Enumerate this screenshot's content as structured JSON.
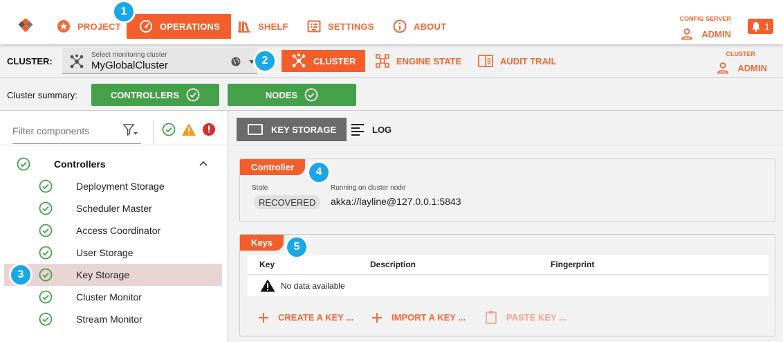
{
  "topnav": {
    "items": [
      {
        "label": "PROJECT",
        "icon": "star-circle-icon"
      },
      {
        "label": "OPERATIONS",
        "icon": "speedometer-icon",
        "active": true
      },
      {
        "label": "SHELF",
        "icon": "books-icon"
      },
      {
        "label": "SETTINGS",
        "icon": "settings-list-icon"
      },
      {
        "label": "ABOUT",
        "icon": "info-icon"
      }
    ],
    "config_server_label": "CONFIG SERVER",
    "config_user": "ADMIN",
    "notification_count": "1"
  },
  "clusterbar": {
    "label": "CLUSTER:",
    "select_hint": "Select monitoring cluster",
    "select_value": "MyGlobalCluster",
    "tabs": [
      {
        "label": "CLUSTER",
        "active": true
      },
      {
        "label": "ENGINE STATE"
      },
      {
        "label": "AUDIT TRAIL"
      }
    ],
    "cluster_label": "CLUSTER",
    "cluster_user": "ADMIN"
  },
  "summary": {
    "label": "Cluster summary:",
    "controllers": "CONTROLLERS",
    "nodes": "NODES"
  },
  "sidebar": {
    "filter_placeholder": "Filter components",
    "group": "Controllers",
    "items": [
      {
        "label": "Deployment Storage"
      },
      {
        "label": "Scheduler Master"
      },
      {
        "label": "Access Coordinator"
      },
      {
        "label": "User Storage"
      },
      {
        "label": "Key Storage",
        "selected": true
      },
      {
        "label": "Cluster Monitor"
      },
      {
        "label": "Stream Monitor"
      }
    ]
  },
  "main": {
    "tabs": [
      {
        "label": "KEY STORAGE",
        "active": true
      },
      {
        "label": "LOG"
      }
    ],
    "controller": {
      "title": "Controller",
      "state_label": "State",
      "state_value": "RECOVERED",
      "node_label": "Running on cluster node",
      "node_value": "akka://layline@127.0.0.1:5843"
    },
    "keys": {
      "title": "Keys",
      "columns": [
        "Key",
        "Description",
        "Fingerprint"
      ],
      "empty_text": "No data available",
      "actions": [
        "CREATE A KEY ...",
        "IMPORT A KEY ...",
        "PASTE KEY ..."
      ]
    }
  },
  "callouts": [
    "1",
    "2",
    "3",
    "4",
    "5"
  ],
  "colors": {
    "accent": "#f25f2c",
    "success": "#45a04a",
    "callout": "#1aa7e8"
  }
}
